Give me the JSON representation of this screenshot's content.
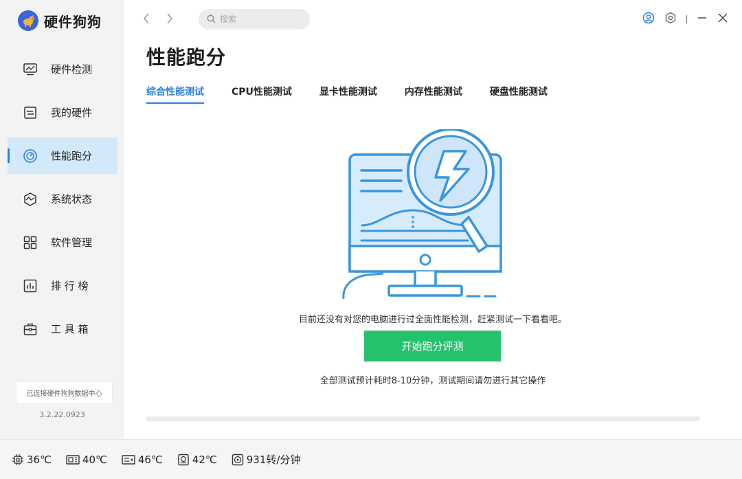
{
  "app": {
    "name": "硬件狗狗",
    "connection_status": "已连接硬件狗狗数据中心",
    "version": "3.2.22.0923"
  },
  "sidebar": {
    "items": [
      {
        "label": "硬件检测",
        "icon": "monitor-chart-icon",
        "active": false
      },
      {
        "label": "我的硬件",
        "icon": "hardware-chip-icon",
        "active": false
      },
      {
        "label": "性能跑分",
        "icon": "speedometer-icon",
        "active": true
      },
      {
        "label": "系统状态",
        "icon": "system-pulse-icon",
        "active": false
      },
      {
        "label": "软件管理",
        "icon": "apps-grid-icon",
        "active": false
      },
      {
        "label": "排 行 榜",
        "icon": "ranking-chart-icon",
        "active": false
      },
      {
        "label": "工 具 箱",
        "icon": "toolbox-icon",
        "active": false
      }
    ]
  },
  "topbar": {
    "search_placeholder": "搜索"
  },
  "page": {
    "title": "性能跑分",
    "tabs": [
      {
        "label": "综合性能测试",
        "active": true
      },
      {
        "label": "CPU性能测试",
        "active": false
      },
      {
        "label": "显卡性能测试",
        "active": false
      },
      {
        "label": "内存性能测试",
        "active": false
      },
      {
        "label": "硬盘性能测试",
        "active": false
      }
    ],
    "message": "目前还没有对您的电脑进行过全面性能检测，赶紧测试一下看看吧。",
    "start_button": "开始跑分评测",
    "hint": "全部测试预计耗时8-10分钟，测试期间请勿进行其它操作",
    "progress": 0
  },
  "statusbar": {
    "sensors": [
      {
        "icon": "cpu-icon",
        "value": "36℃"
      },
      {
        "icon": "gpu-icon",
        "value": "40℃"
      },
      {
        "icon": "motherboard-icon",
        "value": "46℃"
      },
      {
        "icon": "disk-icon",
        "value": "42℃"
      },
      {
        "icon": "fan-icon",
        "value": "931转/分钟"
      }
    ]
  },
  "colors": {
    "accent": "#2b7fe0",
    "active_bg": "#d2e9fa",
    "start_button": "#25c26e",
    "sidebar_bg": "#f3f3f3",
    "illustration": "#3a96dd"
  }
}
